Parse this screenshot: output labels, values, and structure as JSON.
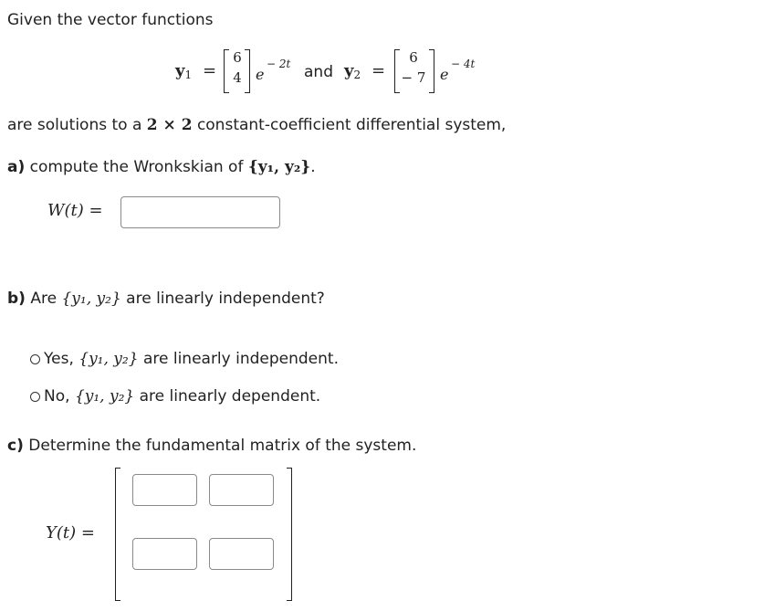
{
  "intro": "Given the vector functions",
  "equation": {
    "y1_label": "y",
    "y1_sub": "1",
    "eq": "=",
    "y1_vector": [
      "6",
      "4"
    ],
    "y1_exp_base": "e",
    "y1_exp": "− 2t",
    "and": "and",
    "y2_label": "y",
    "y2_sub": "2",
    "y2_vector": [
      "6",
      "− 7"
    ],
    "y2_exp_base": "e",
    "y2_exp": "− 4t"
  },
  "statement": {
    "pre": "are solutions to a",
    "dims": "2 × 2",
    "post": "constant-coefficient differential system,"
  },
  "part_a": {
    "label": "a)",
    "text": "compute the Wronkskian of",
    "set": "{y₁, y₂}",
    "end": ".",
    "w_label": "W(t) =",
    "w_value": ""
  },
  "part_b": {
    "label": "b)",
    "text_pre": "Are",
    "set": "{y₁, y₂}",
    "text_post": "are linearly independent?",
    "options": [
      {
        "pre": "Yes,",
        "set": "{y₁, y₂}",
        "post": "are linearly independent.",
        "selected": false
      },
      {
        "pre": "No,",
        "set": "{y₁, y₂}",
        "post": "are linearly dependent.",
        "selected": false
      }
    ]
  },
  "part_c": {
    "label": "c)",
    "text": "Determine the fundamental matrix of the system.",
    "y_label": "Y(t) =",
    "matrix": [
      [
        "",
        ""
      ],
      [
        "",
        ""
      ]
    ]
  }
}
